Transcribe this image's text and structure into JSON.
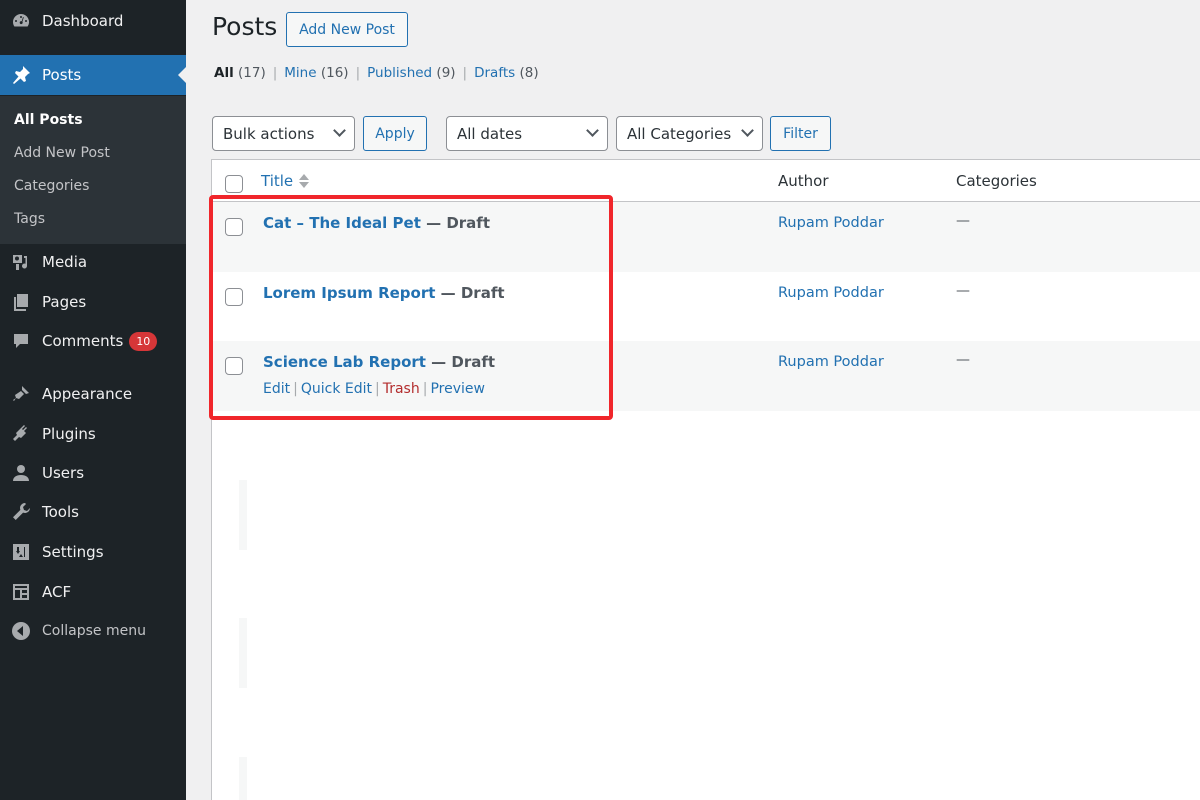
{
  "sidebar": {
    "items": [
      {
        "label": "Dashboard",
        "icon": "dashboard-icon"
      },
      {
        "label": "Posts",
        "icon": "pin-icon",
        "active": true
      },
      {
        "label": "Media",
        "icon": "media-icon"
      },
      {
        "label": "Pages",
        "icon": "pages-icon"
      },
      {
        "label": "Comments",
        "icon": "comments-icon",
        "badge": "10"
      },
      {
        "label": "Appearance",
        "icon": "paintbrush-icon"
      },
      {
        "label": "Plugins",
        "icon": "plugin-icon"
      },
      {
        "label": "Users",
        "icon": "user-icon"
      },
      {
        "label": "Tools",
        "icon": "wrench-icon"
      },
      {
        "label": "Settings",
        "icon": "settings-icon"
      },
      {
        "label": "ACF",
        "icon": "acf-icon"
      },
      {
        "label": "Collapse menu",
        "icon": "collapse-icon"
      }
    ],
    "submenu": [
      "All Posts",
      "Add New Post",
      "Categories",
      "Tags"
    ]
  },
  "header": {
    "title": "Posts",
    "add_new_label": "Add New Post"
  },
  "views": [
    {
      "label": "All",
      "count": "(17)"
    },
    {
      "label": "Mine",
      "count": "(16)"
    },
    {
      "label": "Published",
      "count": "(9)"
    },
    {
      "label": "Drafts",
      "count": "(8)"
    }
  ],
  "toolbar": {
    "bulk_actions": "Bulk actions",
    "apply_label": "Apply",
    "dates": "All dates",
    "categories": "All Categories",
    "filter_label": "Filter"
  },
  "table": {
    "columns": [
      "Title",
      "Author",
      "Categories"
    ],
    "rows": [
      {
        "title": "Cat – The Ideal Pet",
        "state": " — Draft",
        "author": "Rupam Poddar",
        "categories": "—"
      },
      {
        "title": "Lorem Ipsum Report",
        "state": " — Draft",
        "author": "Rupam Poddar",
        "categories": "—"
      },
      {
        "title": "Science Lab Report",
        "state": " — Draft",
        "author": "Rupam Poddar",
        "categories": "—"
      }
    ],
    "row_actions": [
      "Edit",
      "Quick Edit",
      "Trash",
      "Preview"
    ]
  },
  "colors": {
    "accent": "#2271b1",
    "sidebar_bg": "#1d2327",
    "highlight": "#f0262b",
    "trash": "#b32d2e",
    "badge": "#d63638"
  }
}
